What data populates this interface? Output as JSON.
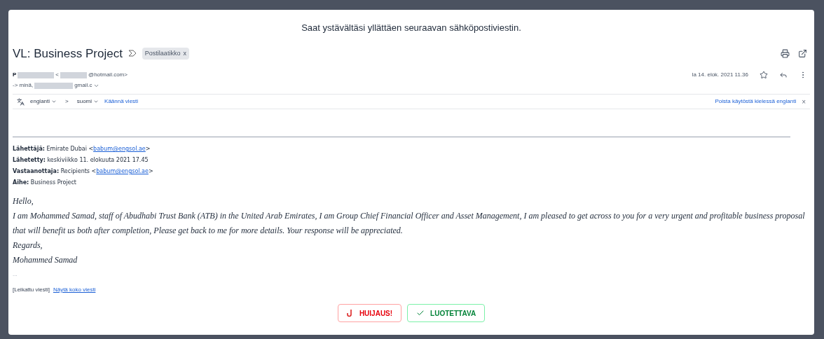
{
  "banner": "Saat ystävältäsi yllättäen seuraavan sähköpostiviestin.",
  "subject": "VL: Business Project",
  "label_chip": "Postilaatikko",
  "chip_close": "x",
  "sender": {
    "name": "P",
    "address_lt": "<",
    "address": "@hotmail.com>",
    "to_prefix": "-> minä,",
    "to_address": "gmail.c",
    "date": "la 14. elok. 2021 11.36"
  },
  "translate": {
    "from": "englanti",
    "arrow": ">",
    "to": "suomi",
    "action": "Käännä viesti",
    "disable": "Poista käytöstä kielessä englanti",
    "close": "×"
  },
  "forward_header": [
    {
      "label": "Lähettäjä:",
      "text": "Emirate Dubai <",
      "link": "babum@engsol.ae",
      "after": ">"
    },
    {
      "label": "Lähetetty:",
      "text": "keskiviikko 11. elokuuta 2021 17.45"
    },
    {
      "label": "Vastaanottaja:",
      "text": "Recipients <",
      "link": "babum@engsol.ae",
      "after": ">"
    },
    {
      "label": "Aihe:",
      "text": "Business Project"
    }
  ],
  "body": [
    "Hello,",
    "I am Mohammed Samad, staff of Abudhabi Trust Bank (ATB) in the United Arab Emirates, I am Group Chief Financial Officer and Asset Management, I am pleased to get across to you for a very urgent and profitable business proposal that will benefit us both after completion, Please get back to me for more details. Your response will be appreciated.",
    "Regards,",
    "Mohammed Samad"
  ],
  "ellipsis": "...",
  "clipped": "[Leikattu viesti]",
  "show_full": "Näytä koko viesti",
  "buttons": [
    {
      "kind": "scam",
      "label": "HUIJAUS!"
    },
    {
      "kind": "trusted",
      "label": "LUOTETTAVA"
    }
  ]
}
